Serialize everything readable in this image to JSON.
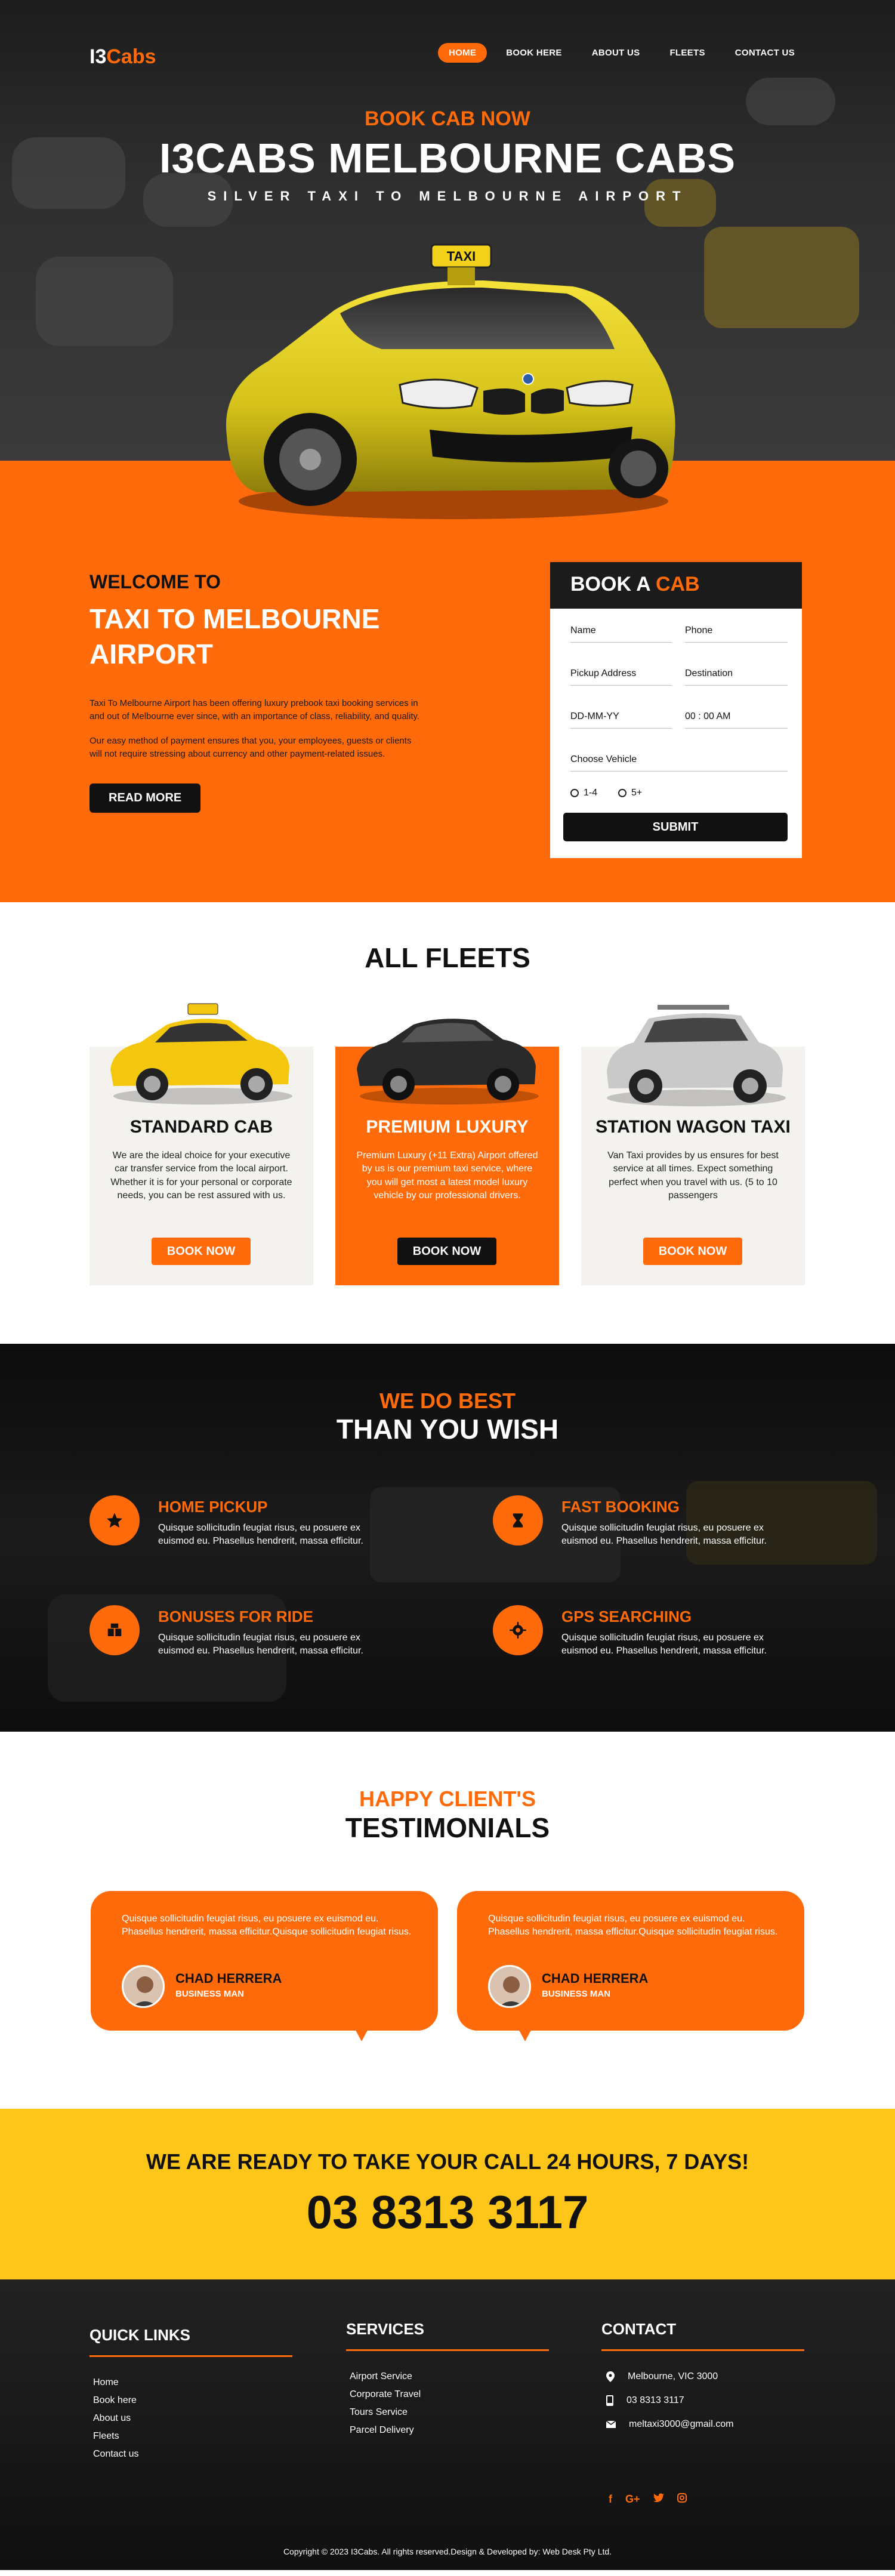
{
  "brand": {
    "logo_prefix": "I3",
    "logo_accent": "Cabs",
    "accent_color": "#ff6b0b",
    "yellow_color": "#fdc619"
  },
  "nav": {
    "items": [
      "HOME",
      "BOOK HERE",
      "ABOUT US",
      "FLEETS",
      "CONTACT US"
    ],
    "active": "HOME"
  },
  "hero": {
    "kicker": "BOOK CAB NOW",
    "title": "I3CABS MELBOURNE CABS",
    "subtitle": "SILVER TAXI TO MELBOURNE AIRPORT",
    "car_sign": "TAXI"
  },
  "welcome": {
    "heading": "WELCOME TO",
    "title_line1": "TAXI TO MELBOURNE",
    "title_line2": "AIRPORT",
    "p1": "Taxi To Melbourne Airport has been offering luxury prebook taxi booking services in and out of Melbourne ever since, with an importance of class, reliability, and quality.",
    "p2": "Our easy method of payment ensures that you, your employees, guests or clients will not require stressing about currency and other payment-related issues.",
    "button": "READ MORE"
  },
  "booking": {
    "title": "BOOK A",
    "title_accent": "CAB",
    "fields": {
      "name": "Name",
      "phone": "Phone",
      "pickup": "Pickup Address",
      "destination": "Destination",
      "date": "DD-MM-YY",
      "time": "00 : 00 AM",
      "vehicle": "Choose Vehicle"
    },
    "radio_options": [
      "1-4",
      "5+"
    ],
    "submit": "SUBMIT"
  },
  "fleets": {
    "title": "ALL FLEETS",
    "cards": [
      {
        "name": "STANDARD CAB",
        "desc": "We are the ideal choice for your executive car transfer service from the local airport. Whether it is for your personal or corporate needs, you can be rest assured with us.",
        "button": "BOOK NOW"
      },
      {
        "name": "PREMIUM LUXURY",
        "desc": "Premium Luxury (+11 Extra) Airport offered by us is our premium taxi service, where you will get most a latest model luxury vehicle by our professional drivers.",
        "button": "BOOK NOW"
      },
      {
        "name": "STATION WAGON TAXI",
        "desc": "Van Taxi provides by us ensures for best service at all times. Expect something perfect when you travel with us. (5 to 10 passengers",
        "button": "BOOK NOW"
      }
    ]
  },
  "best": {
    "kicker": "WE DO BEST",
    "title": "THAN YOU WISH",
    "features": [
      {
        "title": "HOME PICKUP",
        "icon": "star-icon",
        "text": "Quisque sollicitudin feugiat risus, eu posuere ex euismod eu. Phasellus hendrerit, massa efficitur."
      },
      {
        "title": "FAST BOOKING",
        "icon": "hourglass-icon",
        "text": "Quisque sollicitudin feugiat risus, eu posuere ex euismod eu. Phasellus hendrerit, massa efficitur."
      },
      {
        "title": "BONUSES FOR RIDE",
        "icon": "gifts-icon",
        "text": "Quisque sollicitudin feugiat risus, eu posuere ex euismod eu. Phasellus hendrerit, massa efficitur."
      },
      {
        "title": "GPS SEARCHING",
        "icon": "gear-icon",
        "text": "Quisque sollicitudin feugiat risus, eu posuere ex euismod eu. Phasellus hendrerit, massa efficitur."
      }
    ]
  },
  "testimonials": {
    "kicker": "HAPPY CLIENT'S",
    "title": "TESTIMONIALS",
    "items": [
      {
        "text": "Quisque sollicitudin feugiat risus, eu posuere ex euismod eu. Phasellus hendrerit, massa efficitur.Quisque sollicitudin feugiat risus.",
        "name": "CHAD HERRERA",
        "role": "BUSINESS MAN"
      },
      {
        "text": "Quisque sollicitudin feugiat risus, eu posuere ex euismod eu. Phasellus hendrerit, massa efficitur.Quisque sollicitudin feugiat risus.",
        "name": "CHAD HERRERA",
        "role": "BUSINESS MAN"
      }
    ]
  },
  "call": {
    "heading": "WE ARE READY TO TAKE YOUR CALL 24 HOURS, 7 DAYS!",
    "number": "03 8313 3117"
  },
  "footer": {
    "quick_links_title": "QUICK LINKS",
    "quick_links": [
      "Home",
      "Book here",
      "About us",
      "Fleets",
      "Contact us"
    ],
    "services_title": "SERVICES",
    "services": [
      "Airport Service",
      "Corporate Travel",
      "Tours Service",
      "Parcel Delivery"
    ],
    "contact_title": "CONTACT",
    "address": "Melbourne, VIC 3000",
    "phone": "03 8313 3117",
    "email": "meltaxi3000@gmail.com",
    "social": [
      "f",
      "G+",
      "twitter",
      "instagram"
    ],
    "copyright": "Copyright © 2023 I3Cabs. All rights reserved.Design & Developed by: Web Desk Pty Ltd."
  }
}
